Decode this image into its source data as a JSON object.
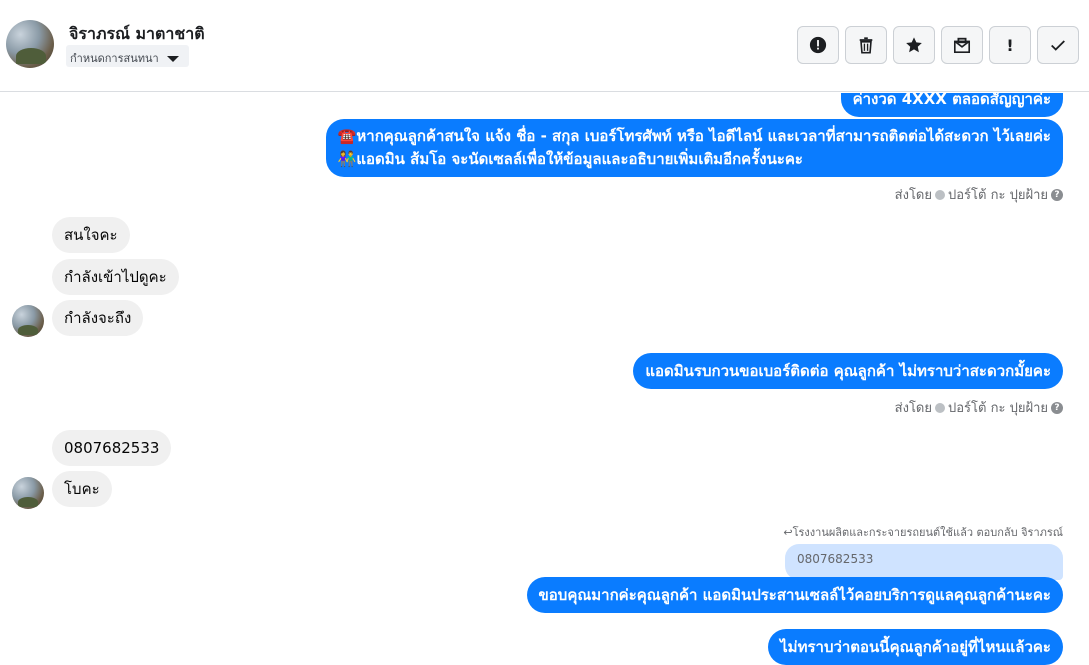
{
  "header": {
    "contact_name": "จิราภรณ์ มาตาชาติ",
    "label_select": "กำหนดการสนทนา"
  },
  "toolbar": [
    {
      "name": "report-spam-button",
      "icon": "alert-circle-icon"
    },
    {
      "name": "delete-button",
      "icon": "trash-icon"
    },
    {
      "name": "star-button",
      "icon": "star-icon"
    },
    {
      "name": "mark-unread-button",
      "icon": "envelope-icon"
    },
    {
      "name": "follow-up-button",
      "icon": "exclamation-icon",
      "glyph": "!"
    },
    {
      "name": "mark-done-button",
      "icon": "checkmark-icon"
    }
  ],
  "messages": {
    "out_partial": "ค่างวด 4XXX ตลอดสัญญาค่ะ",
    "out_1_line1": "☎️หากคุณลูกค้าสนใจ แจ้ง ชื่อ - สกุล เบอร์โทรศัพท์ หรือ ไอดีไลน์ และเวลาที่สามารถติดต่อได้สะดวก ไว้เลยค่ะ",
    "out_1_line2": "👫แอดมิน ส้มโอ จะนัดเซลล์เพื่อให้ข้อมูลและอธิบายเพิ่มเติมอีกครั้งนะคะ",
    "sent_by_1": "ส่งโดย",
    "sent_by_1_agent": "ปอร์โต้ กะ ปุยฝ้าย",
    "in_1": "สนใจคะ",
    "in_2": "กำลังเข้าไปดูคะ",
    "in_3": "กำลังจะถึง",
    "out_2": "แอดมินรบกวนขอเบอร์ติดต่อ คุณลูกค้า ไม่ทราบว่าสะดวกมั้ยคะ",
    "sent_by_2": "ส่งโดย",
    "sent_by_2_agent": "ปอร์โต้ กะ ปุยฝ้าย",
    "in_4": "0807682533",
    "in_5": "โบคะ",
    "reply_note": "↩โรงงานผลิตและกระจายรถยนต์ใช้แล้ว ตอบกลับ จิราภรณ์",
    "quoted": "0807682533",
    "out_3": "ขอบคุณมากค่ะคุณลูกค้า แอดมินประสานเซลล์ไว้คอยบริการดูแลคุณลูกค้านะคะ",
    "out_4": "ไม่ทราบว่าตอนนี้คุณลูกค้าอยู่ที่ไหนแล้วคะ"
  },
  "colors": {
    "outgoing_bubble": "#0a7cff",
    "incoming_bubble": "#f0f0f0",
    "quoted_bubble": "#cfe3ff"
  }
}
